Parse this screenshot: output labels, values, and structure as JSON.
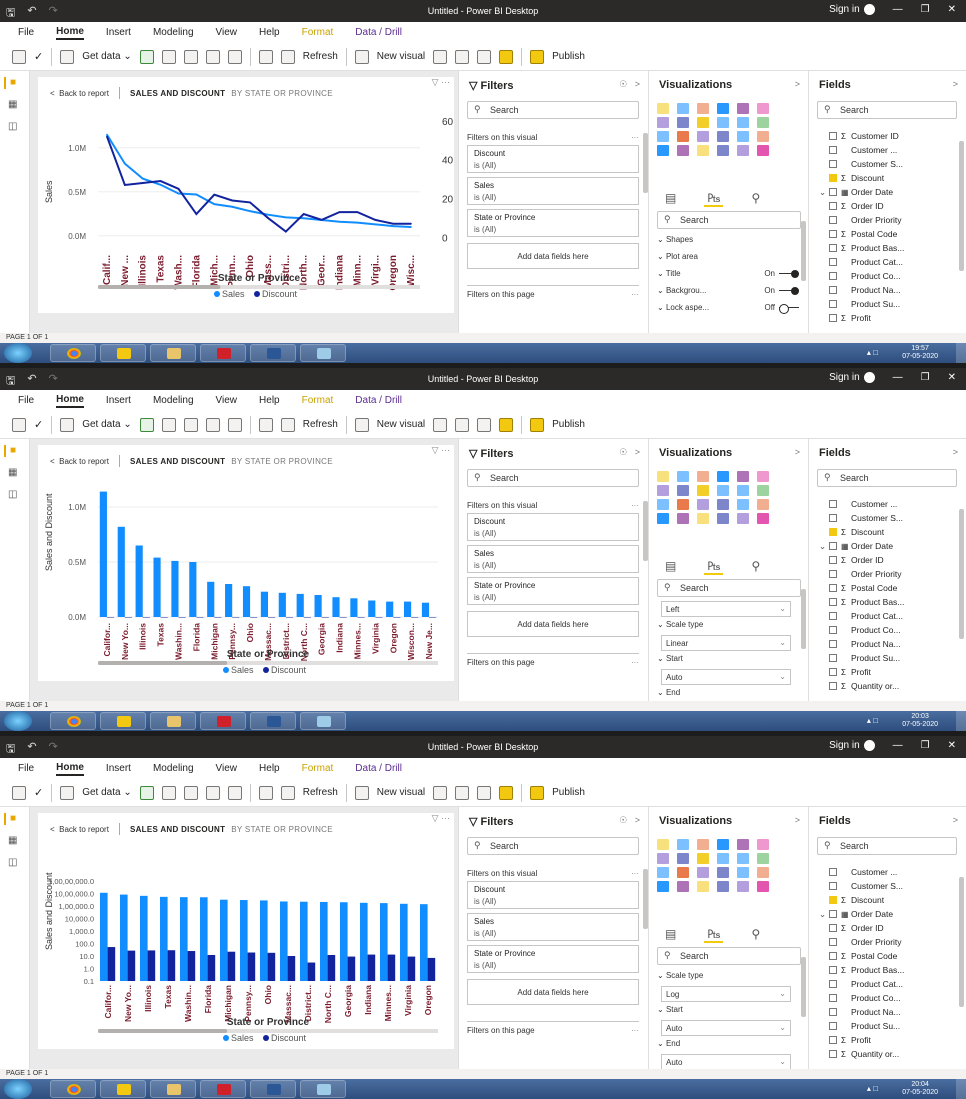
{
  "screens": [
    {
      "title": "Untitled - Power BI Desktop",
      "sign_in": "Sign in",
      "menu": [
        "File",
        "Home",
        "Insert",
        "Modeling",
        "View",
        "Help",
        "Format",
        "Data / Drill"
      ],
      "ribbon": {
        "get_data": "Get data",
        "refresh": "Refresh",
        "new_visual": "New visual",
        "publish": "Publish"
      },
      "visual": {
        "back": "Back to report",
        "title": "SALES AND DISCOUNT",
        "subtitle": "BY STATE OR PROVINCE"
      },
      "filters": {
        "title": "Filters",
        "search": "Search",
        "on_visual": "Filters on this visual",
        "cards": [
          {
            "name": "Discount",
            "value": "is (All)"
          },
          {
            "name": "Sales",
            "value": "is (All)"
          },
          {
            "name": "State or Province",
            "value": "is (All)"
          }
        ],
        "add": "Add data fields here",
        "on_page": "Filters on this page"
      },
      "viz": {
        "title": "Visualizations",
        "search": "Search",
        "props": [
          {
            "label": "Shapes",
            "value": ""
          },
          {
            "label": "Plot area",
            "value": ""
          },
          {
            "label": "Title",
            "value": "On"
          },
          {
            "label": "Backgrou...",
            "value": "On"
          },
          {
            "label": "Lock aspe...",
            "value": "Off"
          }
        ]
      },
      "fields": {
        "title": "Fields",
        "search": "Search",
        "items": [
          {
            "label": "Customer ID",
            "sigma": true,
            "checked": false,
            "exp": ""
          },
          {
            "label": "Customer ...",
            "sigma": false,
            "checked": false,
            "exp": ""
          },
          {
            "label": "Customer S...",
            "sigma": false,
            "checked": false,
            "exp": ""
          },
          {
            "label": "Discount",
            "sigma": true,
            "checked": true,
            "exp": ""
          },
          {
            "label": "Order Date",
            "sigma": false,
            "checked": false,
            "exp": "v",
            "cal": true
          },
          {
            "label": "Order ID",
            "sigma": true,
            "checked": false,
            "exp": ""
          },
          {
            "label": "Order Priority",
            "sigma": false,
            "checked": false,
            "exp": ""
          },
          {
            "label": "Postal Code",
            "sigma": true,
            "checked": false,
            "exp": ""
          },
          {
            "label": "Product Bas...",
            "sigma": true,
            "checked": false,
            "exp": ""
          },
          {
            "label": "Product Cat...",
            "sigma": false,
            "checked": false,
            "exp": ""
          },
          {
            "label": "Product Co...",
            "sigma": false,
            "checked": false,
            "exp": ""
          },
          {
            "label": "Product Na...",
            "sigma": false,
            "checked": false,
            "exp": ""
          },
          {
            "label": "Product Su...",
            "sigma": false,
            "checked": false,
            "exp": ""
          },
          {
            "label": "Profit",
            "sigma": true,
            "checked": false,
            "exp": ""
          }
        ]
      },
      "page": "PAGE 1 OF 1",
      "clock": {
        "time": "19:57",
        "date": "07-05-2020"
      }
    },
    {
      "title": "Untitled - Power BI Desktop",
      "sign_in": "Sign in",
      "menu": [
        "File",
        "Home",
        "Insert",
        "Modeling",
        "View",
        "Help",
        "Format",
        "Data / Drill"
      ],
      "ribbon": {
        "get_data": "Get data",
        "refresh": "Refresh",
        "new_visual": "New visual",
        "publish": "Publish"
      },
      "visual": {
        "back": "Back to report",
        "title": "SALES AND DISCOUNT",
        "subtitle": "BY STATE OR PROVINCE"
      },
      "filters": {
        "title": "Filters",
        "search": "Search",
        "on_visual": "Filters on this visual",
        "cards": [
          {
            "name": "Discount",
            "value": "is (All)"
          },
          {
            "name": "Sales",
            "value": "is (All)"
          },
          {
            "name": "State or Province",
            "value": "is (All)"
          }
        ],
        "add": "Add data fields here",
        "on_page": "Filters on this page"
      },
      "viz": {
        "title": "Visualizations",
        "search": "Search",
        "props": [
          {
            "label": "Left",
            "value": "",
            "dd": true
          },
          {
            "label": "Scale type",
            "value": ""
          },
          {
            "label": "Linear",
            "value": "",
            "dd": true
          },
          {
            "label": "Start",
            "value": ""
          },
          {
            "label": "Auto",
            "value": "",
            "dd": true
          },
          {
            "label": "End",
            "value": ""
          }
        ]
      },
      "fields": {
        "title": "Fields",
        "search": "Search",
        "items": [
          {
            "label": "Customer ...",
            "sigma": false,
            "checked": false,
            "exp": ""
          },
          {
            "label": "Customer S...",
            "sigma": false,
            "checked": false,
            "exp": ""
          },
          {
            "label": "Discount",
            "sigma": true,
            "checked": true,
            "exp": ""
          },
          {
            "label": "Order Date",
            "sigma": false,
            "checked": false,
            "exp": "v",
            "cal": true
          },
          {
            "label": "Order ID",
            "sigma": true,
            "checked": false,
            "exp": ""
          },
          {
            "label": "Order Priority",
            "sigma": false,
            "checked": false,
            "exp": ""
          },
          {
            "label": "Postal Code",
            "sigma": true,
            "checked": false,
            "exp": ""
          },
          {
            "label": "Product Bas...",
            "sigma": true,
            "checked": false,
            "exp": ""
          },
          {
            "label": "Product Cat...",
            "sigma": false,
            "checked": false,
            "exp": ""
          },
          {
            "label": "Product Co...",
            "sigma": false,
            "checked": false,
            "exp": ""
          },
          {
            "label": "Product Na...",
            "sigma": false,
            "checked": false,
            "exp": ""
          },
          {
            "label": "Product Su...",
            "sigma": false,
            "checked": false,
            "exp": ""
          },
          {
            "label": "Profit",
            "sigma": true,
            "checked": false,
            "exp": ""
          },
          {
            "label": "Quantity or...",
            "sigma": true,
            "checked": false,
            "exp": ""
          }
        ]
      },
      "page": "PAGE 1 OF 1",
      "clock": {
        "time": "20:03",
        "date": "07-05-2020"
      }
    },
    {
      "title": "Untitled - Power BI Desktop",
      "sign_in": "Sign in",
      "menu": [
        "File",
        "Home",
        "Insert",
        "Modeling",
        "View",
        "Help",
        "Format",
        "Data / Drill"
      ],
      "ribbon": {
        "get_data": "Get data",
        "refresh": "Refresh",
        "new_visual": "New visual",
        "publish": "Publish"
      },
      "visual": {
        "back": "Back to report",
        "title": "SALES AND DISCOUNT",
        "subtitle": "BY STATE OR PROVINCE"
      },
      "filters": {
        "title": "Filters",
        "search": "Search",
        "on_visual": "Filters on this visual",
        "cards": [
          {
            "name": "Discount",
            "value": "is (All)"
          },
          {
            "name": "Sales",
            "value": "is (All)"
          },
          {
            "name": "State or Province",
            "value": "is (All)"
          }
        ],
        "add": "Add data fields here",
        "on_page": "Filters on this page"
      },
      "viz": {
        "title": "Visualizations",
        "search": "Search",
        "props": [
          {
            "label": "Scale type",
            "value": ""
          },
          {
            "label": "Log",
            "value": "",
            "dd": true
          },
          {
            "label": "Start",
            "value": ""
          },
          {
            "label": "Auto",
            "value": "",
            "dd": true
          },
          {
            "label": "End",
            "value": ""
          },
          {
            "label": "Auto",
            "value": "",
            "dd": true
          }
        ]
      },
      "fields": {
        "title": "Fields",
        "search": "Search",
        "items": [
          {
            "label": "Customer ...",
            "sigma": false,
            "checked": false,
            "exp": ""
          },
          {
            "label": "Customer S...",
            "sigma": false,
            "checked": false,
            "exp": ""
          },
          {
            "label": "Discount",
            "sigma": true,
            "checked": true,
            "exp": ""
          },
          {
            "label": "Order Date",
            "sigma": false,
            "checked": false,
            "exp": "v",
            "cal": true
          },
          {
            "label": "Order ID",
            "sigma": true,
            "checked": false,
            "exp": ""
          },
          {
            "label": "Order Priority",
            "sigma": false,
            "checked": false,
            "exp": ""
          },
          {
            "label": "Postal Code",
            "sigma": true,
            "checked": false,
            "exp": ""
          },
          {
            "label": "Product Bas...",
            "sigma": true,
            "checked": false,
            "exp": ""
          },
          {
            "label": "Product Cat...",
            "sigma": false,
            "checked": false,
            "exp": ""
          },
          {
            "label": "Product Co...",
            "sigma": false,
            "checked": false,
            "exp": ""
          },
          {
            "label": "Product Na...",
            "sigma": false,
            "checked": false,
            "exp": ""
          },
          {
            "label": "Product Su...",
            "sigma": false,
            "checked": false,
            "exp": ""
          },
          {
            "label": "Profit",
            "sigma": true,
            "checked": false,
            "exp": ""
          },
          {
            "label": "Quantity or...",
            "sigma": true,
            "checked": false,
            "exp": ""
          }
        ]
      },
      "page": "PAGE 1 OF 1",
      "clock": {
        "time": "20:04",
        "date": "07-05-2020"
      }
    }
  ],
  "colors": {
    "sales": "#118dff",
    "discount": "#12239e",
    "label": "#7b1c2e",
    "accent": "#f2c811"
  },
  "chart_data": [
    {
      "type": "line",
      "title": "SALES AND DISCOUNT BY STATE OR PROVINCE",
      "xlabel": "State or Province",
      "ylabel": "Sales",
      "categories": [
        "Calif...",
        "New ...",
        "Illinois",
        "Texas",
        "Wash...",
        "Florida",
        "Mich...",
        "Penn...",
        "Ohio",
        "Mass...",
        "Distri...",
        "North...",
        "Geor...",
        "Indiana",
        "Minn...",
        "Virgi...",
        "Oregon",
        "Wisc..."
      ],
      "y_ticks": [
        "1.0M",
        "0.5M",
        "0.0M"
      ],
      "y2_ticks": [
        "60",
        "40",
        "20",
        "0"
      ],
      "ylim": [
        -0.15,
        1.35
      ],
      "y2lim": [
        -6,
        62
      ],
      "series": [
        {
          "name": "Sales",
          "axis": "left",
          "values": [
            1.15,
            0.82,
            0.65,
            0.58,
            0.48,
            0.47,
            0.36,
            0.33,
            0.28,
            0.24,
            0.21,
            0.2,
            0.18,
            0.16,
            0.15,
            0.13,
            0.11,
            0.1
          ]
        },
        {
          "name": "Discount",
          "axis": "right",
          "values": [
            52,
            27,
            28,
            29,
            25,
            12,
            22,
            19,
            18,
            10,
            3,
            12,
            9,
            13,
            13,
            9,
            7,
            7
          ]
        }
      ],
      "legend": "bottom"
    },
    {
      "type": "bar",
      "title": "SALES AND DISCOUNT BY STATE OR PROVINCE",
      "xlabel": "State or Province",
      "ylabel": "Sales and Discount",
      "categories": [
        "Califor...",
        "New Yo...",
        "Illinois",
        "Texas",
        "Washin...",
        "Florida",
        "Michigan",
        "Pennsy...",
        "Ohio",
        "Massac...",
        "District...",
        "North C...",
        "Georgia",
        "Indiana",
        "Minnes...",
        "Virginia",
        "Oregon",
        "Wiscon...",
        "New Je..."
      ],
      "y_ticks": [
        "1.0M",
        "0.5M",
        "0.0M"
      ],
      "ylim": [
        0,
        1.2
      ],
      "series": [
        {
          "name": "Sales",
          "values": [
            1.14,
            0.82,
            0.65,
            0.54,
            0.51,
            0.5,
            0.32,
            0.3,
            0.28,
            0.23,
            0.22,
            0.21,
            0.2,
            0.18,
            0.17,
            0.15,
            0.14,
            0.14,
            0.13
          ]
        },
        {
          "name": "Discount",
          "values": [
            5e-05,
            3e-05,
            3e-05,
            3e-05,
            3e-05,
            1e-05,
            2e-05,
            2e-05,
            2e-05,
            1e-05,
            3e-06,
            1e-05,
            1e-05,
            1e-05,
            1e-05,
            1e-05,
            1e-05,
            1e-05,
            1e-05
          ]
        }
      ],
      "legend": "bottom"
    },
    {
      "type": "bar",
      "title": "SALES AND DISCOUNT BY STATE OR PROVINCE",
      "xlabel": "State or Province",
      "ylabel": "Sales and Discount",
      "log_scale": true,
      "categories": [
        "Califor...",
        "New Yo...",
        "Illinois",
        "Texas",
        "Washin...",
        "Florida",
        "Michigan",
        "Pennsy...",
        "Ohio",
        "Massac...",
        "District...",
        "North C...",
        "Georgia",
        "Indiana",
        "Minnes...",
        "Virginia",
        "Oregon"
      ],
      "y_ticks": [
        "1,00,00,000.0",
        "10,00,000.0",
        "1,00,000.0",
        "10,000.0",
        "1,000.0",
        "100.0",
        "10.0",
        "1.0",
        "0.1"
      ],
      "ylim": [
        0.1,
        10000000
      ],
      "series": [
        {
          "name": "Sales",
          "values": [
            1140000,
            820000,
            650000,
            540000,
            510000,
            500000,
            320000,
            300000,
            280000,
            230000,
            220000,
            210000,
            200000,
            180000,
            170000,
            150000,
            140000
          ]
        },
        {
          "name": "Discount",
          "values": [
            52,
            27,
            28,
            29,
            25,
            12,
            22,
            19,
            18,
            10,
            3,
            12,
            9,
            13,
            13,
            9,
            7
          ]
        }
      ],
      "legend": "bottom"
    }
  ]
}
